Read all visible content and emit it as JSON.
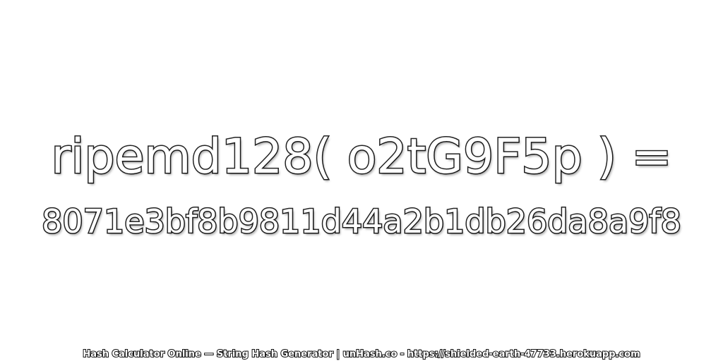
{
  "expression": "ripemd128( o2tG9F5p ) =",
  "hash_value": "8071e3bf8b9811d44a2b1db26da8a9f8",
  "footer": "Hash Calculator Online — String Hash Generator | unHash.co - https://shielded-earth-47733.herokuapp.com",
  "colors": {
    "background": "#ffffff",
    "text_fill": "#ffffff",
    "text_outline": "#222222"
  }
}
